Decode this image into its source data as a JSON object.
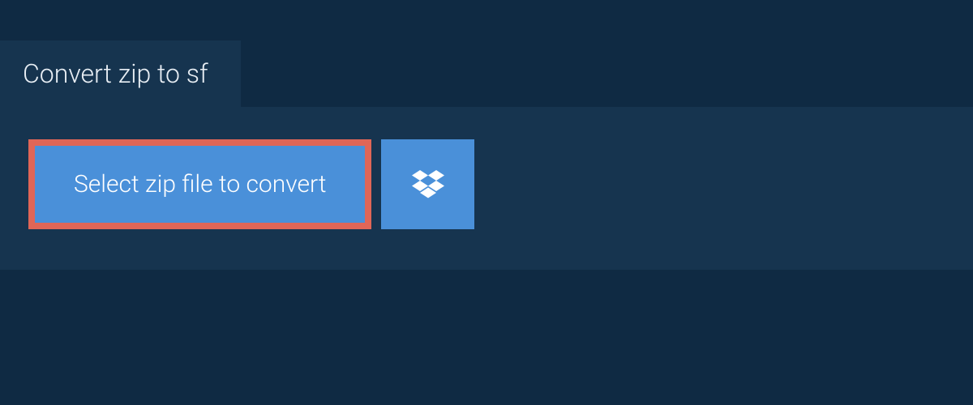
{
  "header": {
    "title": "Convert zip to sf"
  },
  "actions": {
    "select_file_label": "Select zip file to convert"
  },
  "colors": {
    "page_bg": "#0f2a43",
    "panel_bg": "#16344f",
    "button_bg": "#4a90d9",
    "highlight_border": "#e06657",
    "text_light": "#ffffff"
  }
}
